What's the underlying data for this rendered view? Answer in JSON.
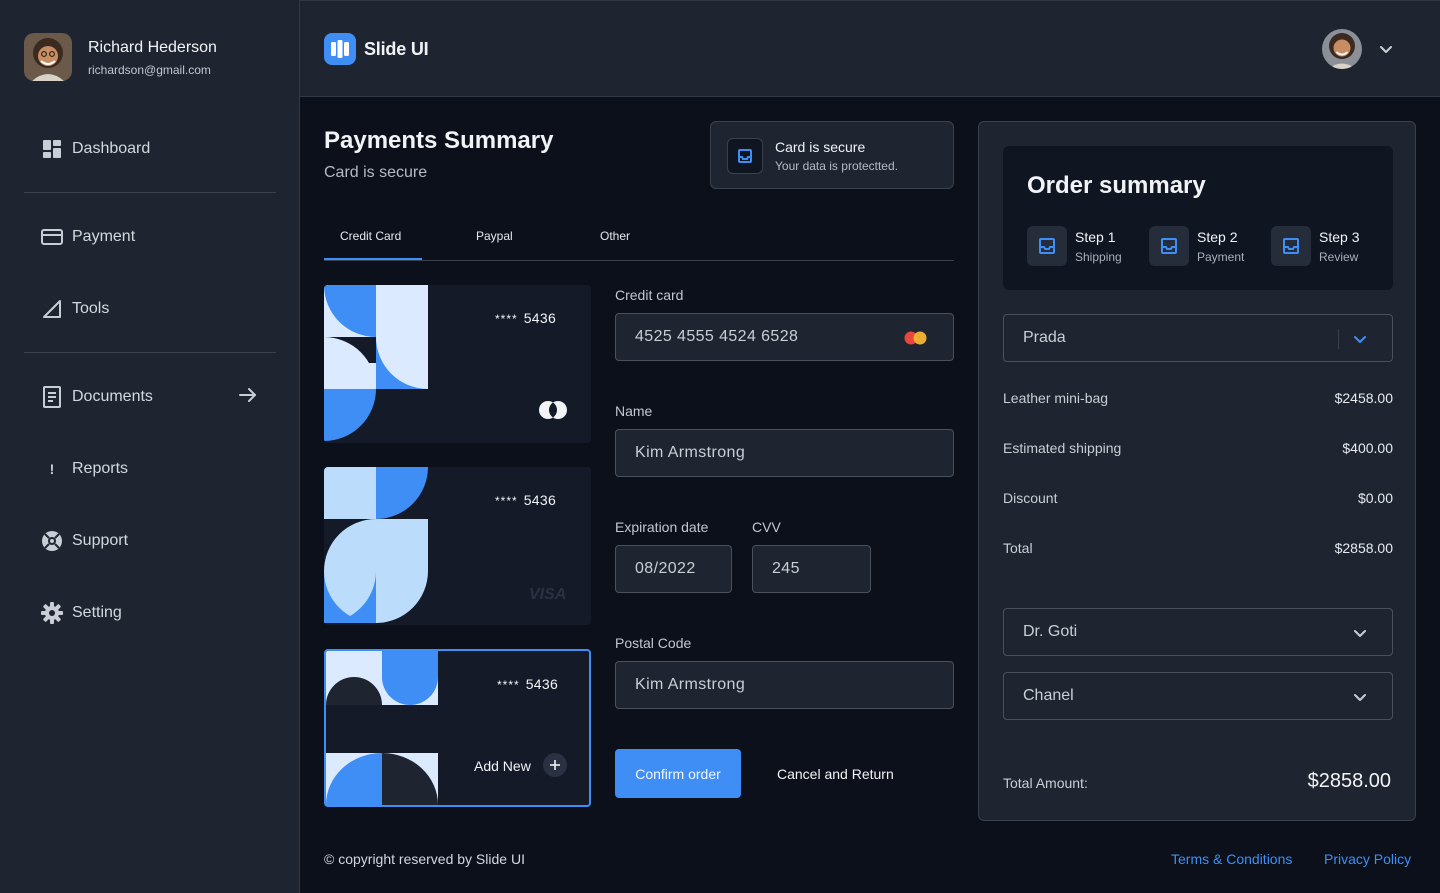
{
  "user": {
    "name": "Richard Hederson",
    "email": "richardson@gmail.com"
  },
  "sidebar": {
    "items": [
      {
        "label": "Dashboard",
        "icon": "dashboard-icon"
      },
      {
        "label": "Payment",
        "icon": "credit-card-icon"
      },
      {
        "label": "Tools",
        "icon": "triangle-ruler-icon"
      },
      {
        "label": "Documents",
        "icon": "document-icon"
      },
      {
        "label": "Reports",
        "icon": "exclamation-icon"
      },
      {
        "label": "Support",
        "icon": "lifebuoy-icon"
      },
      {
        "label": "Setting",
        "icon": "gear-icon"
      }
    ]
  },
  "header": {
    "brand": "Slide UI"
  },
  "payments": {
    "title": "Payments Summary",
    "subtitle": "Card is secure",
    "secure_title": "Card is secure",
    "secure_sub": "Your data is protectted.",
    "tabs": [
      "Credit Card",
      "Paypal",
      "Other"
    ],
    "active_tab": "Credit Card",
    "cards": [
      {
        "stars": "****",
        "last4": "5436",
        "brand": "mastercard"
      },
      {
        "stars": "****",
        "last4": "5436",
        "brand": "VISA"
      },
      {
        "stars": "****",
        "last4": "5436",
        "add_label": "Add New"
      }
    ]
  },
  "form": {
    "credit_card_label": "Credit card",
    "credit_card_value": "4525 4555 4524 6528",
    "name_label": "Name",
    "name_value": "Kim Armstrong",
    "expiration_label": "Expiration date",
    "expiration_value": "08/2022",
    "cvv_label": "CVV",
    "cvv_value": "245",
    "postal_label": "Postal Code",
    "postal_value": "Kim Armstrong",
    "confirm_label": "Confirm order",
    "cancel_label": "Cancel and Return"
  },
  "order": {
    "title": "Order summary",
    "steps": [
      {
        "title": "Step 1",
        "sub": "Shipping"
      },
      {
        "title": "Step 2",
        "sub": "Payment"
      },
      {
        "title": "Step 3",
        "sub": "Review"
      }
    ],
    "brand_select": "Prada",
    "lines": [
      {
        "label": "Leather mini-bag",
        "value": "$2458.00"
      },
      {
        "label": "Estimated shipping",
        "value": "$400.00"
      },
      {
        "label": "Discount",
        "value": "$0.00"
      },
      {
        "label": "Total",
        "value": "$2858.00"
      }
    ],
    "select_2": "Dr. Goti",
    "select_3": "Chanel",
    "total_amount_label": "Total Amount:",
    "total_amount_value": "$2858.00"
  },
  "footer": {
    "copyright": "© copyright reserved by Slide UI",
    "terms": "Terms & Conditions",
    "privacy": "Privacy Policy"
  },
  "colors": {
    "accent": "#3e8ef5",
    "panel": "#1f2530",
    "background": "#0b101b",
    "card_light": "#dbeafe",
    "card_mid": "#bcdcfb"
  }
}
